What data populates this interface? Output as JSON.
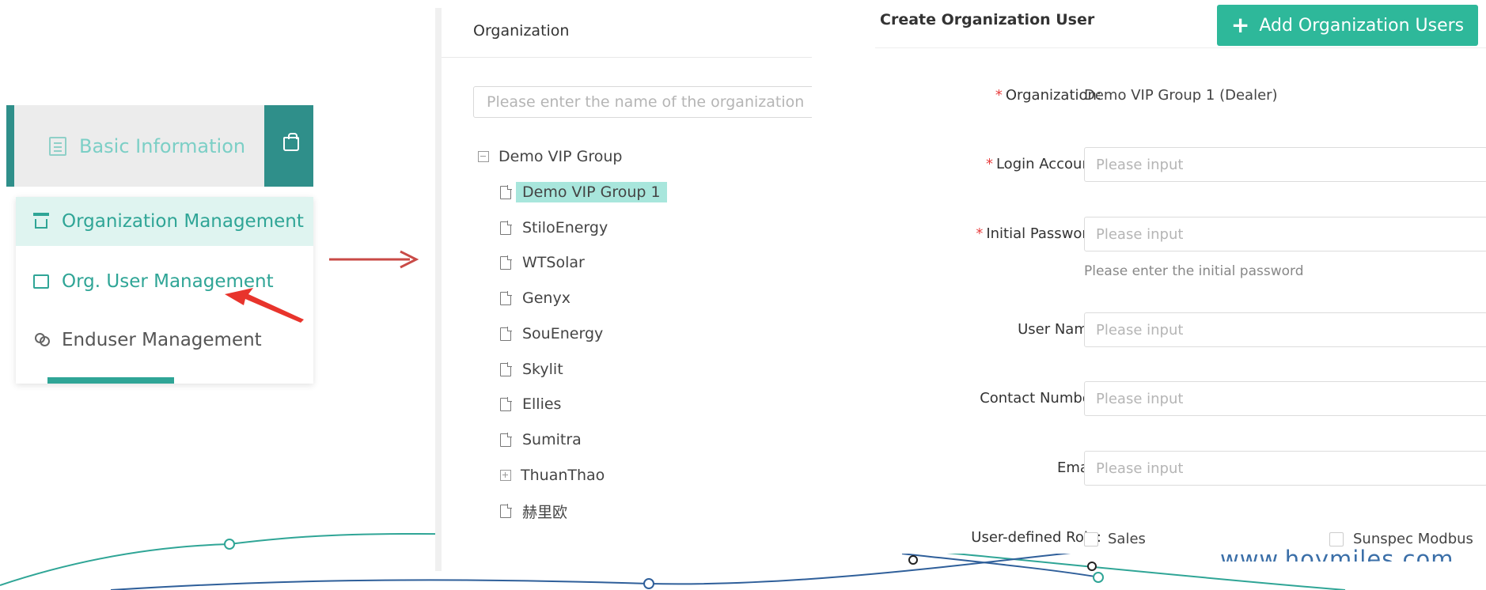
{
  "colors": {
    "accent": "#2eb89a",
    "menu_header": "#2f8f8a",
    "required": "#e84040",
    "arrow": "#c94a46",
    "selected_node": "#a8e6dc",
    "website": "#3b6fa8"
  },
  "menu": {
    "header_label": "Basic Information",
    "header_icon": "document-icon",
    "bag_icon": "shopping-bag-icon",
    "items": [
      {
        "label": "Organization Management",
        "icon": "org-chart-icon",
        "active": true
      },
      {
        "label": "Org. User Management",
        "icon": "id-card-icon",
        "active": false
      },
      {
        "label": "Enduser Management",
        "icon": "users-icon",
        "active": false
      }
    ]
  },
  "tree": {
    "title": "Organization",
    "search_placeholder": "Please enter the name of the organization",
    "root": "Demo VIP Group",
    "children": [
      {
        "label": "Demo VIP Group 1",
        "selected": true,
        "expandable": false
      },
      {
        "label": "StiloEnergy",
        "selected": false,
        "expandable": false
      },
      {
        "label": "WTSolar",
        "selected": false,
        "expandable": false
      },
      {
        "label": "Genyx",
        "selected": false,
        "expandable": false
      },
      {
        "label": "SouEnergy",
        "selected": false,
        "expandable": false
      },
      {
        "label": "Skylit",
        "selected": false,
        "expandable": false
      },
      {
        "label": "Ellies",
        "selected": false,
        "expandable": false
      },
      {
        "label": "Sumitra",
        "selected": false,
        "expandable": false
      },
      {
        "label": "ThuanThao",
        "selected": false,
        "expandable": true
      },
      {
        "label": "赫里欧",
        "selected": false,
        "expandable": false
      }
    ]
  },
  "form": {
    "title": "Create Organization User",
    "add_button_label": "Add Organization Users",
    "fields": {
      "organization": {
        "label": "Organization:",
        "required": true,
        "value": "Demo VIP Group 1  (Dealer)"
      },
      "login_account": {
        "label": "Login Account:",
        "required": true,
        "placeholder": "Please input"
      },
      "initial_password": {
        "label": "Initial Password:",
        "required": true,
        "placeholder": "Please input",
        "hint": "Please enter the initial password"
      },
      "user_name": {
        "label": "User Name:",
        "required": false,
        "placeholder": "Please input"
      },
      "contact_number": {
        "label": "Contact Number:",
        "required": false,
        "placeholder": "Please input"
      },
      "email": {
        "label": "Email:",
        "required": false,
        "placeholder": "Please input"
      },
      "user_defined_role": {
        "label": "User-defined Role:",
        "options": [
          "Sales",
          "Sunspec Modbus"
        ]
      }
    }
  },
  "footer": {
    "website": "www.hoymiles.com"
  }
}
